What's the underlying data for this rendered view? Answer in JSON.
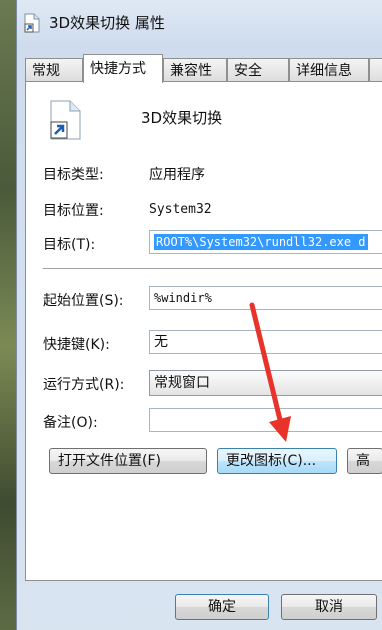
{
  "window": {
    "title": "3D效果切换 属性"
  },
  "tabs": [
    {
      "label": "常规"
    },
    {
      "label": "快捷方式"
    },
    {
      "label": "兼容性"
    },
    {
      "label": "安全"
    },
    {
      "label": "详细信息"
    },
    {
      "label": ""
    }
  ],
  "shortcut": {
    "name": "3D效果切换",
    "target_type_label": "目标类型:",
    "target_type_value": "应用程序",
    "target_location_label": "目标位置:",
    "target_location_value": "System32",
    "target_label": "目标(T):",
    "target_value": "ROOT%\\System32\\rundll32.exe d",
    "start_in_label": "起始位置(S):",
    "start_in_value": "%windir%",
    "hotkey_label": "快捷键(K):",
    "hotkey_value": "无",
    "run_label": "运行方式(R):",
    "run_value": "常规窗口",
    "comment_label": "备注(O):",
    "comment_value": ""
  },
  "buttons": {
    "open_location": "打开文件位置(F)",
    "change_icon": "更改图标(C)...",
    "advanced": "高",
    "ok": "确定",
    "cancel": "取消"
  },
  "icons": {
    "title": "shortcut-file-icon",
    "big": "shortcut-file-icon",
    "annotation": "red-arrow-icon"
  },
  "colors": {
    "selection": "#3399ff",
    "arrow": "#e8322a"
  }
}
